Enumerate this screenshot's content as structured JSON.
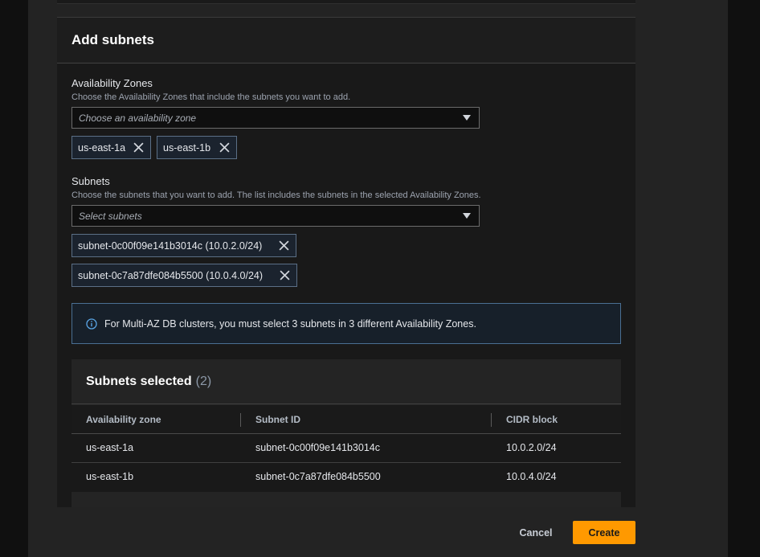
{
  "panel": {
    "title": "Add subnets"
  },
  "availability_zones": {
    "label": "Availability Zones",
    "description": "Choose the Availability Zones that include the subnets you want to add.",
    "placeholder": "Choose an availability zone",
    "selected": [
      "us-east-1a",
      "us-east-1b"
    ]
  },
  "subnets": {
    "label": "Subnets",
    "description": "Choose the subnets that you want to add. The list includes the subnets in the selected Availability Zones.",
    "placeholder": "Select subnets",
    "selected": [
      "subnet-0c00f09e141b3014c (10.0.2.0/24)",
      "subnet-0c7a87dfe084b5500 (10.0.4.0/24)"
    ]
  },
  "info": {
    "text": "For Multi-AZ DB clusters, you must select 3 subnets in 3 different Availability Zones."
  },
  "selected_table": {
    "title": "Subnets selected",
    "count": "(2)",
    "columns": [
      "Availability zone",
      "Subnet ID",
      "CIDR block"
    ],
    "rows": [
      [
        "us-east-1a",
        "subnet-0c00f09e141b3014c",
        "10.0.2.0/24"
      ],
      [
        "us-east-1b",
        "subnet-0c7a87dfe084b5500",
        "10.0.4.0/24"
      ]
    ]
  },
  "footer": {
    "cancel_label": "Cancel",
    "create_label": "Create"
  },
  "colors": {
    "accent": "#ff9900",
    "info_border": "#4a6f93",
    "token_border": "#5b6f86"
  },
  "icons": {
    "dropdown": "caret-down-icon",
    "remove": "close-icon",
    "info": "info-icon"
  }
}
